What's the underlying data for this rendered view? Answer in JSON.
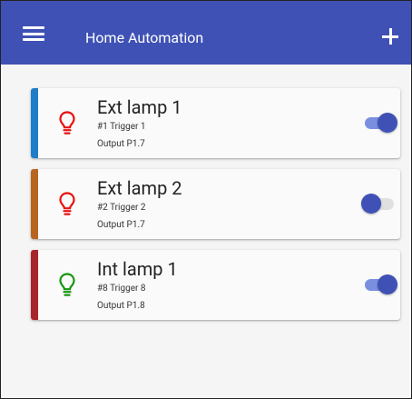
{
  "app": {
    "title": "Home Automation"
  },
  "icons": {
    "menu": "menu-icon",
    "add": "add-icon",
    "lamp": "lightbulb-icon"
  },
  "colors": {
    "appbar": "#3f51b5",
    "toggle_on_thumb": "#3f51b5",
    "toggle_on_track": "#7b8fe0"
  },
  "devices": [
    {
      "name": "Ext lamp 1",
      "trigger": "#1 Trigger 1",
      "output": "Output P1.7",
      "bar_color": "#1e7dc8",
      "bulb_color": "#e81010",
      "enabled": true
    },
    {
      "name": "Ext lamp 2",
      "trigger": "#2 Trigger 2",
      "output": "Output P1.7",
      "bar_color": "#b9651f",
      "bulb_color": "#e81010",
      "enabled": false
    },
    {
      "name": "Int lamp 1",
      "trigger": "#8 Trigger 8",
      "output": "Output P1.8",
      "bar_color": "#a8262a",
      "bulb_color": "#16960e",
      "enabled": true
    }
  ]
}
